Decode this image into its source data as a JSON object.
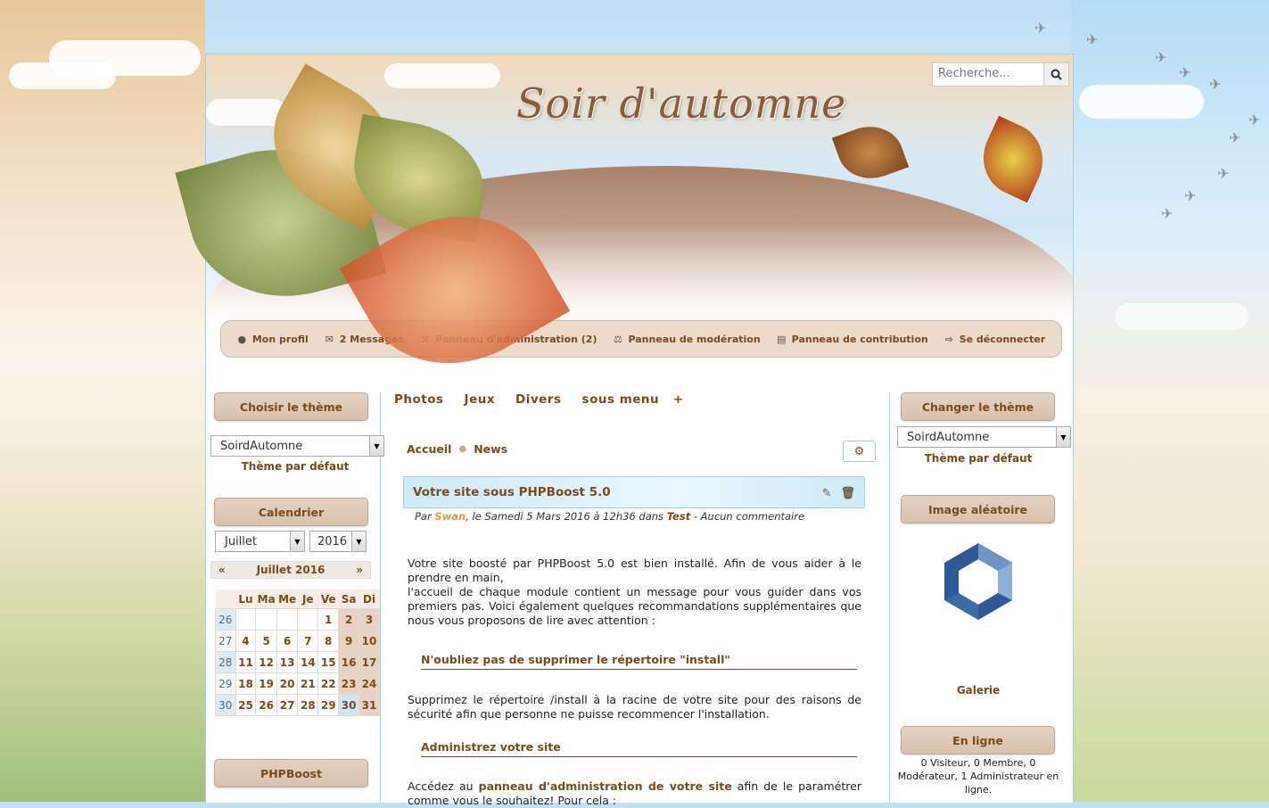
{
  "header": {
    "site_title": "Soir d'automne",
    "search_placeholder": "Recherche..."
  },
  "userbar": {
    "items": [
      {
        "label": "Mon profil",
        "icon": "user-icon"
      },
      {
        "label": "2 Messages",
        "icon": "envelope-icon"
      },
      {
        "label": "Panneau d'administration (2)",
        "icon": "wrench-icon"
      },
      {
        "label": "Panneau de modération",
        "icon": "gavel-icon"
      },
      {
        "label": "Panneau de contribution",
        "icon": "file-icon"
      },
      {
        "label": "Se déconnecter",
        "icon": "sign-out-icon"
      }
    ]
  },
  "left": {
    "theme_title": "Choisir le thème",
    "theme_value": "SoirdAutomne",
    "theme_default": "Thème par défaut",
    "calendar_title": "Calendrier",
    "month_value": "Juillet",
    "year_value": "2016",
    "cal_header": "Juillet 2016",
    "days": [
      "Lu",
      "Ma",
      "Me",
      "Je",
      "Ve",
      "Sa",
      "Di"
    ],
    "weeks": [
      {
        "wk": "26",
        "days": [
          "",
          "",
          "",
          "",
          "1",
          "2",
          "3"
        ]
      },
      {
        "wk": "27",
        "days": [
          "4",
          "5",
          "6",
          "7",
          "8",
          "9",
          "10"
        ]
      },
      {
        "wk": "28",
        "days": [
          "11",
          "12",
          "13",
          "14",
          "15",
          "16",
          "17"
        ]
      },
      {
        "wk": "29",
        "days": [
          "18",
          "19",
          "20",
          "21",
          "22",
          "23",
          "24"
        ]
      },
      {
        "wk": "30",
        "days": [
          "25",
          "26",
          "27",
          "28",
          "29",
          "30",
          "31"
        ]
      }
    ],
    "phpboost_title": "PHPBoost"
  },
  "main": {
    "nav": [
      "Photos",
      "Jeux",
      "Divers",
      "sous menu"
    ],
    "nav_plus": "+",
    "breadcrumb": [
      "Accueil",
      "News"
    ],
    "news_title": "Votre site sous PHPBoost 5.0",
    "meta_par": "Par",
    "meta_author": "Swan",
    "meta_date": ", le Samedi 5 Mars 2016 à 12h36 dans",
    "meta_cat": "Test",
    "meta_comments": "- Aucun commentaire",
    "p1": "Votre site boosté par PHPBoost 5.0 est bien installé. Afin de vous aider à le prendre en main,",
    "p1b": "l'accueil de chaque module contient un message pour vous guider dans vos premiers pas. Voici également quelques recommandations supplémentaires que nous vous proposons de lire avec attention :",
    "h1": "N'oubliez pas de supprimer le répertoire \"install\"",
    "p2": "Supprimez le répertoire /install à la racine de votre site pour des raisons de sécurité afin que personne ne puisse recommencer l'installation.",
    "h2": "Administrez votre site",
    "p3_a": "Accédez au",
    "p3_link": "panneau d'administration de votre site",
    "p3_b": "afin de le paramétrer comme vous le souhaitez! Pour cela :"
  },
  "right": {
    "theme_title": "Changer le thème",
    "theme_value": "SoirdAutomne",
    "theme_default": "Thème par défaut",
    "image_title": "Image aléatoire",
    "gallery_label": "Galerie",
    "online_title": "En ligne",
    "online_text": "0 Visiteur, 0 Membre, 0 Modérateur, 1 Administrateur en ligne."
  },
  "colors": {
    "accent": "#7a4b1a",
    "border_blue": "#9ed3e8"
  }
}
